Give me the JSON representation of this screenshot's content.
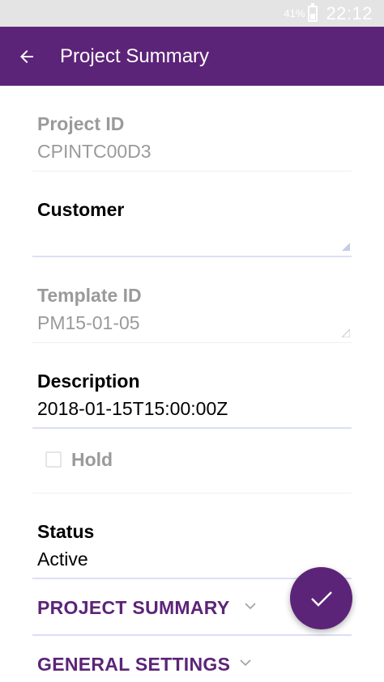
{
  "status_bar": {
    "battery": "41%",
    "time": "22:12"
  },
  "app_bar": {
    "title": "Project Summary"
  },
  "fields": {
    "project_id": {
      "label": "Project ID",
      "value": "CPINTC00D3"
    },
    "customer": {
      "label": "Customer",
      "value": ""
    },
    "template_id": {
      "label": "Template ID",
      "value": "PM15-01-05"
    },
    "description": {
      "label": "Description",
      "value": "2018-01-15T15:00:00Z"
    },
    "hold": {
      "label": "Hold",
      "checked": false
    },
    "status": {
      "label": "Status",
      "value": "Active"
    }
  },
  "sections": {
    "project_summary": "PROJECT SUMMARY",
    "general_settings": "GENERAL SETTINGS"
  },
  "colors": {
    "primary": "#5c2478",
    "disabled_text": "#9a9a9a",
    "underline": "#dcdff5"
  },
  "icons": {
    "back": "arrow-back-icon",
    "save": "check-icon",
    "expand": "chevron-down-icon"
  }
}
